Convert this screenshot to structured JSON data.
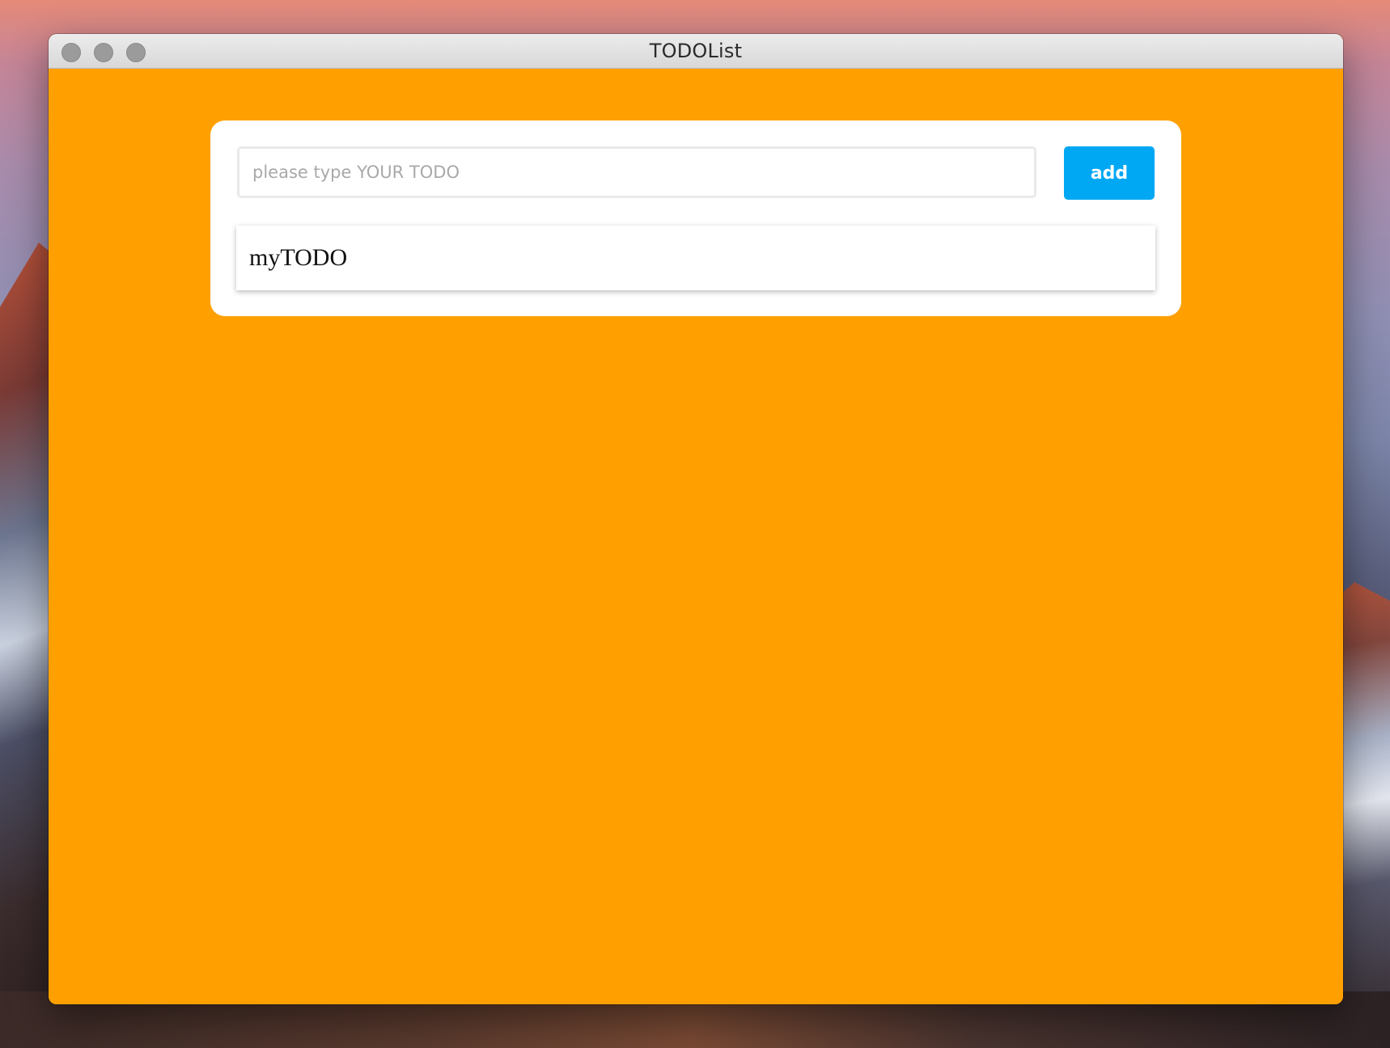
{
  "window": {
    "title": "TODOList"
  },
  "todo_form": {
    "input_value": "",
    "input_placeholder": "please type YOUR TODO",
    "add_label": "add"
  },
  "todos": [
    {
      "text": "myTODO"
    }
  ],
  "colors": {
    "background": "#ffa000",
    "card": "#ffffff",
    "add_button": "#00a8f4"
  }
}
